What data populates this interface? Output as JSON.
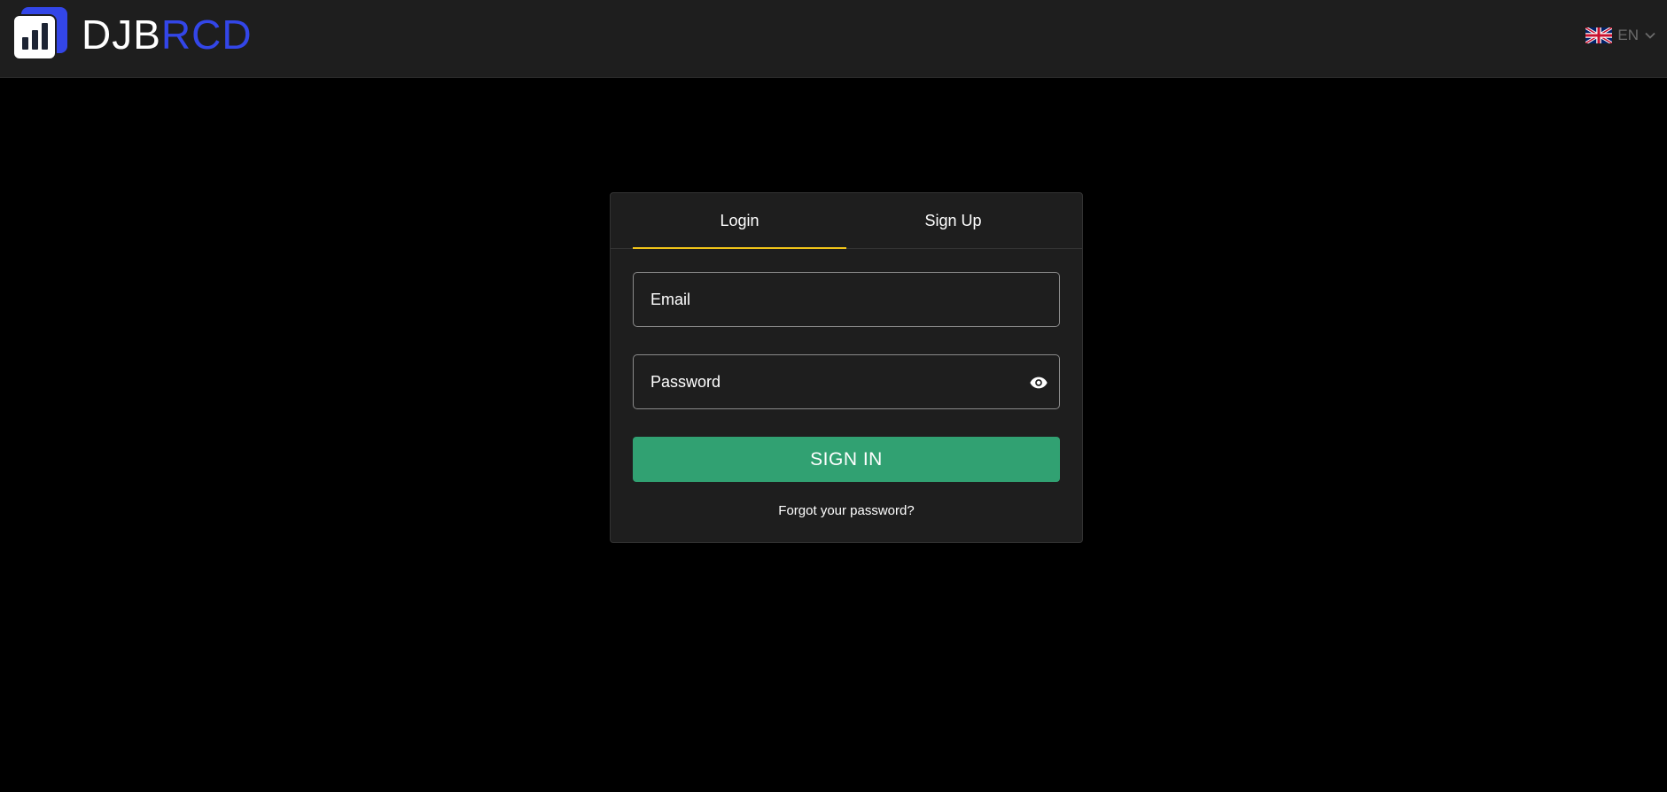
{
  "brand": {
    "name_part1": "DJB",
    "name_part2": "RCD",
    "accent": "#3346e8"
  },
  "language": {
    "code": "EN",
    "flag_icon": "uk-flag-icon"
  },
  "auth": {
    "tabs": [
      {
        "label": "Login",
        "active": true
      },
      {
        "label": "Sign Up",
        "active": false
      }
    ],
    "email_placeholder": "Email",
    "password_placeholder": "Password",
    "submit_label": "SIGN IN",
    "forgot_label": "Forgot your password?",
    "tab_indicator_color": "#f0c419",
    "submit_color": "#31a172"
  }
}
